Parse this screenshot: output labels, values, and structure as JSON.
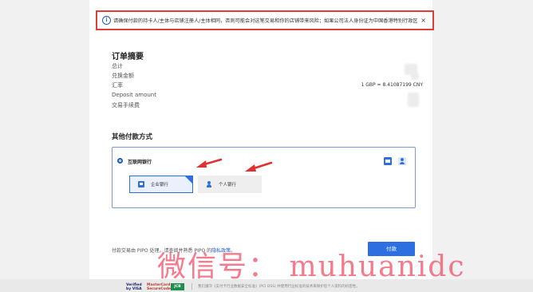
{
  "notice": {
    "text": "请确保付款的持卡人/主体与店铺注册人/主体相同，否则可能会对这笔交易和你的店铺带来风险；如果公司法人身份证为中国香港特别行政区身份证",
    "close": "×"
  },
  "summary": {
    "title": "订单摘要",
    "rows": [
      {
        "label": "总计",
        "value": ""
      },
      {
        "label": "兑换金额",
        "value": ""
      },
      {
        "label": "汇率",
        "value": "1 GBP = 8.41087199 CNY"
      },
      {
        "label": "Deposit amount",
        "value": ""
      },
      {
        "label": "交易手续费",
        "value": ""
      }
    ]
  },
  "other_methods": {
    "title": "其他付款方式",
    "method_label": "互联网银行",
    "options": [
      {
        "label": "企业银行",
        "selected": true
      },
      {
        "label": "个人银行",
        "selected": false
      }
    ]
  },
  "footer": {
    "text_before": "付款交易由 PIPO 处理。请查阅并熟悉 PIPO 的",
    "link": "隐私政策",
    "text_after": "。",
    "pay_button": "付款"
  },
  "watermark": "微信号： muhuanidc",
  "bottom": {
    "logos": [
      "Verified by VISA",
      "MasterCard SecureCode",
      "JCB"
    ],
    "text": "我们遵守《支付卡行业数据安全标准》(PCI DSS) 并使用行业标准的技术来保护您个人资料的机密性。"
  },
  "colors": {
    "accent": "#2d6fe0",
    "notice_border": "#e23b3b",
    "arrow": "#e03030",
    "watermark": "#f0465f"
  }
}
